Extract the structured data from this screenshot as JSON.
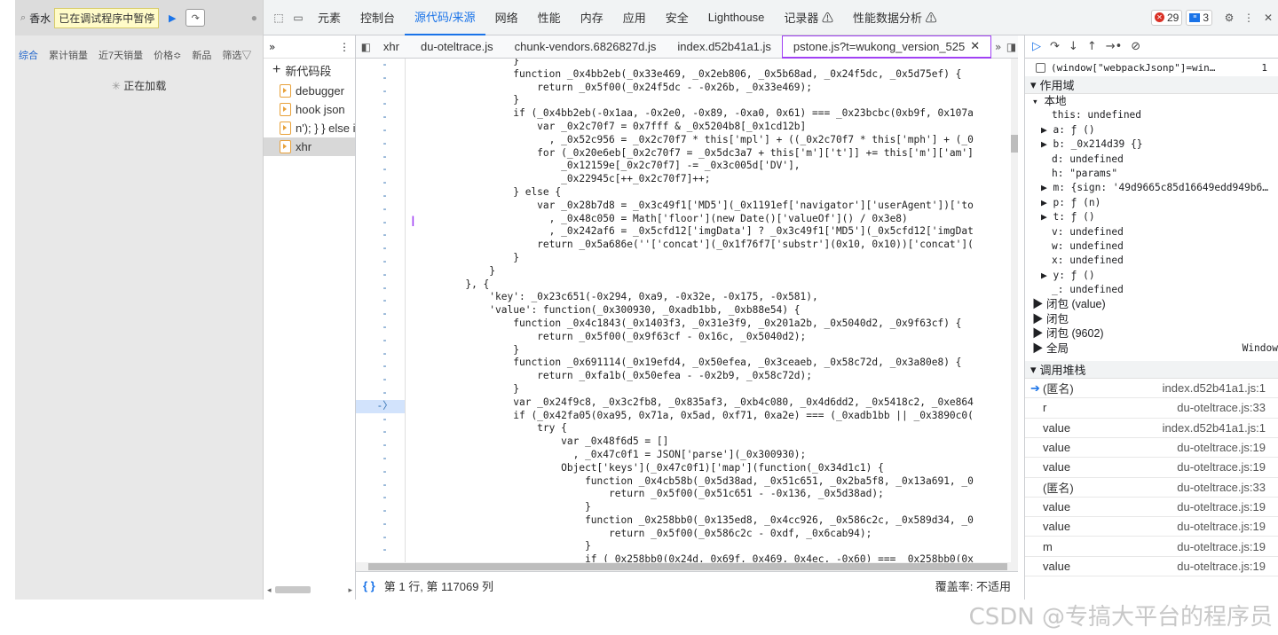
{
  "left": {
    "search_text": "香水",
    "pause_text": "已在调试程序中暂停",
    "tabs": [
      "综合",
      "累计销量",
      "近7天销量",
      "价格≎",
      "新品",
      "筛选▽"
    ],
    "loading": "正在加载"
  },
  "topbar": {
    "tabs": [
      "元素",
      "控制台",
      "源代码/来源",
      "网络",
      "性能",
      "内存",
      "应用",
      "安全",
      "Lighthouse",
      "记录器 ⚠",
      "性能数据分析 ⚠"
    ],
    "active_tab": "源代码/来源",
    "errors": "29",
    "messages": "3"
  },
  "nav": {
    "new_snippet": "新代码段",
    "items": [
      "debugger",
      "hook json",
      "n'); } } else i",
      "xhr"
    ]
  },
  "file_tabs": [
    "xhr",
    "du-oteltrace.js",
    "chunk-vendors.6826827d.js",
    "index.d52b41a1.js",
    "pstone.js?t=wukong_version_525"
  ],
  "code_lines": [
    "                  }",
    "                  function _0x4bb2eb(_0x33e469, _0x2eb806, _0x5b68ad, _0x24f5dc, _0x5d75ef) {",
    "                      return _0x5f00(_0x24f5dc - -0x26b, _0x33e469);",
    "                  }",
    "                  if (_0x4bb2eb(-0x1aa, -0x2e0, -0x89, -0xa0, 0x61) === _0x23bcbc(0xb9f, 0x107a",
    "                      var _0x2c70f7 = 0x7fff & _0x5204b8[_0x1cd12b]",
    "                        , _0x52c956 = _0x2c70f7 * this['mpl'] + ((_0x2c70f7 * this['mph'] + (_0",
    "                      for (_0x20e6eb[_0x2c70f7 = _0x5dc3a7 + this['m']['t']] += this['m']['am']",
    "                          _0x12159e[_0x2c70f7] -= _0x3c005d['DV'],",
    "                          _0x22945c[++_0x2c70f7]++;",
    "                  } else {",
    "                      var _0x28b7d8 = _0x3c49f1['MD5'](_0x1191ef['navigator']['userAgent'])['to",
    "                        , _0x48c050 = Math['floor'](new Date()['valueOf']() / 0x3e8)",
    "                        , _0x242af6 = _0x5cfd12['imgData'] ? _0x3c49f1['MD5'](_0x5cfd12['imgDat",
    "                      return _0x5a686e(''['concat'](_0x1f76f7['substr'](0x10, 0x10))['concat'](",
    "                  }",
    "              }",
    "          }, {",
    "              'key': _0x23c651(-0x294, 0xa9, -0x32e, -0x175, -0x581),",
    "              'value': function(_0x300930, _0xadb1bb, _0xb88e54) {",
    "                  function _0x4c1843(_0x1403f3, _0x31e3f9, _0x201a2b, _0x5040d2, _0x9f63cf) {",
    "                      return _0x5f00(_0x9f63cf - 0x16c, _0x5040d2);",
    "                  }",
    "                  function _0x691114(_0x19efd4, _0x50efea, _0x3ceaeb, _0x58c72d, _0x3a80e8) {",
    "                      return _0xfa1b(_0x50efea - -0x2b9, _0x58c72d);",
    "                  }",
    "                  var _0x24f9c8, _0x3c2fb8, _0x835af3, _0xb4c080, _0x4d6dd2, _0x5418c2, _0xe864",
    "                  if (_0x42fa05(0xa95, 0x71a, 0x5ad, 0xf71, 0xa2e) === (_0xadb1bb || _0x3890c0(",
    "                      try {",
    "                          var _0x48f6d5 = []",
    "                            , _0x47c0f1 = JSON['parse'](_0x300930);",
    "                          Object['keys'](_0x47c0f1)['map'](function(_0x34d1c1) {",
    "                              function _0x4cb58b(_0x5d38ad, _0x51c651, _0x2ba5f8, _0x13a691, _0",
    "                                  return _0x5f00(_0x51c651 - -0x136, _0x5d38ad);",
    "                              }",
    "                              function _0x258bb0(_0x135ed8, _0x4cc926, _0x586c2c, _0x589d34, _0",
    "                                  return _0x5f00(_0x586c2c - 0xdf, _0x6cab94);",
    "                              }",
    "                              if (_0x258bb0(0x24d, 0x69f, 0x469, 0x4ec, -0x60) === _0x258bb0(0x"
  ],
  "status": {
    "position": "第 1 行, 第 117069 列",
    "coverage": "覆盖率: 不适用"
  },
  "right": {
    "breakpoint": "(window[\"webpackJsonp\"]=win…",
    "breakpoint_count": "1",
    "scope_title": "作用域",
    "local": "本地",
    "scope_lines": [
      "this: undefined",
      "▶ a: ƒ ()",
      "▶ b: _0x214d39 {}",
      "d: undefined",
      "h: \"params\"",
      "▶ m: {sign: '49d9665c85d16649edd949b6…",
      "▶ p: ƒ (n)",
      "▶ t: ƒ ()",
      "v: undefined",
      "w: undefined",
      "x: undefined",
      "▶ y: ƒ ()",
      "_: undefined"
    ],
    "closures": [
      "▶ 闭包 (value)",
      "▶ 闭包",
      "▶ 闭包 (9602)",
      "▶ 全局"
    ],
    "global_value": "Window",
    "callstack_title": "调用堆栈",
    "frames": [
      {
        "name": "(匿名)",
        "loc": "index.d52b41a1.js:1"
      },
      {
        "name": "r",
        "loc": "du-oteltrace.js:33"
      },
      {
        "name": "value",
        "loc": "index.d52b41a1.js:1"
      },
      {
        "name": "value",
        "loc": "du-oteltrace.js:19"
      },
      {
        "name": "value",
        "loc": "du-oteltrace.js:19"
      },
      {
        "name": "(匿名)",
        "loc": "du-oteltrace.js:33"
      },
      {
        "name": "value",
        "loc": "du-oteltrace.js:19"
      },
      {
        "name": "value",
        "loc": "du-oteltrace.js:19"
      },
      {
        "name": "m",
        "loc": "du-oteltrace.js:19"
      },
      {
        "name": "value",
        "loc": "du-oteltrace.js:19"
      }
    ]
  },
  "watermark": "CSDN @专搞大平台的程序员"
}
